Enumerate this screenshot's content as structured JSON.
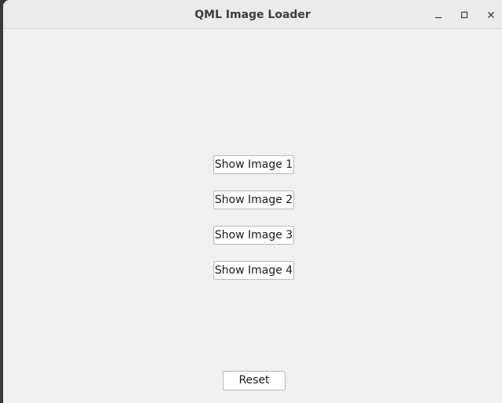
{
  "window": {
    "title": "QML Image Loader"
  },
  "buttons": {
    "show_image_1": "Show Image 1",
    "show_image_2": "Show Image 2",
    "show_image_3": "Show Image 3",
    "show_image_4": "Show Image 4",
    "reset": "Reset"
  },
  "icons": {
    "minimize": "minimize-icon",
    "maximize": "maximize-icon",
    "close": "close-icon"
  },
  "colors": {
    "window_background": "#f0f0f0",
    "titlebar_background": "#ebebeb",
    "button_background": "#ffffff",
    "button_border": "#b8b8b8"
  }
}
